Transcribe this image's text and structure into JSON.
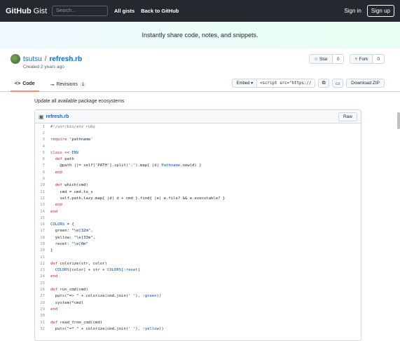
{
  "header": {
    "logo_main": "GitHub",
    "logo_sub": "Gist",
    "search_placeholder": "Search...",
    "nav_all_gists": "All gists",
    "nav_back": "Back to GitHub",
    "sign_in": "Sign in",
    "sign_up": "Sign up"
  },
  "banner": {
    "text": "Instantly share code, notes, and snippets."
  },
  "gist": {
    "owner": "tsutsu",
    "slash": "/",
    "filename": "refresh.rb",
    "created": "Created 2 years ago",
    "star_label": "Star",
    "star_count": "0",
    "fork_label": "Fork",
    "fork_count": "0",
    "tabs": [
      {
        "label": "Code"
      },
      {
        "label": "Revisions",
        "count": "1"
      }
    ],
    "embed_label": "Embed",
    "embed_value": "<script src=\"https://",
    "download": "Download ZIP",
    "description": "Update all available package ecosystems",
    "raw": "Raw"
  },
  "code": {
    "lines": [
      {
        "n": "1",
        "t": "#!/usr/bin/env ruby"
      },
      {
        "n": "2",
        "t": ""
      },
      {
        "n": "3",
        "t": "require 'pathname'"
      },
      {
        "n": "4",
        "t": ""
      },
      {
        "n": "5",
        "t": "class << ENV"
      },
      {
        "n": "6",
        "t": "  def path"
      },
      {
        "n": "7",
        "t": "    @path ||= self['PATH'].split(':').map{ |d| Pathname.new(d) }"
      },
      {
        "n": "8",
        "t": "  end"
      },
      {
        "n": "9",
        "t": ""
      },
      {
        "n": "10",
        "t": "  def which(cmd)"
      },
      {
        "n": "11",
        "t": "    cmd = cmd.to_s"
      },
      {
        "n": "12",
        "t": "    self.path.lazy.map{ |d| d + cmd }.find{ |e| e.file? && e.executable? }"
      },
      {
        "n": "13",
        "t": "  end"
      },
      {
        "n": "14",
        "t": "end"
      },
      {
        "n": "15",
        "t": ""
      },
      {
        "n": "16",
        "t": "COLORS = {"
      },
      {
        "n": "17",
        "t": "  green: \"\\e[32m\","
      },
      {
        "n": "18",
        "t": "  yellow: \"\\e[33m\","
      },
      {
        "n": "19",
        "t": "  reset: \"\\e[0m\""
      },
      {
        "n": "20",
        "t": "}"
      },
      {
        "n": "21",
        "t": ""
      },
      {
        "n": "22",
        "t": "def colorize(str, color)"
      },
      {
        "n": "23",
        "t": "  COLORS[color] + str + COLORS[:reset]"
      },
      {
        "n": "24",
        "t": "end"
      },
      {
        "n": "25",
        "t": ""
      },
      {
        "n": "26",
        "t": "def run_cmd(cmd)"
      },
      {
        "n": "27",
        "t": "  puts(\"=> \" + colorize(cmd.join(' '), :green))"
      },
      {
        "n": "28",
        "t": "  system(*cmd)"
      },
      {
        "n": "29",
        "t": "end"
      },
      {
        "n": "30",
        "t": ""
      },
      {
        "n": "31",
        "t": "def read_from_cmd(cmd)"
      },
      {
        "n": "32",
        "t": "  puts(\"=* \" + colorize(cmd.join(' '), :yellow))"
      }
    ]
  }
}
